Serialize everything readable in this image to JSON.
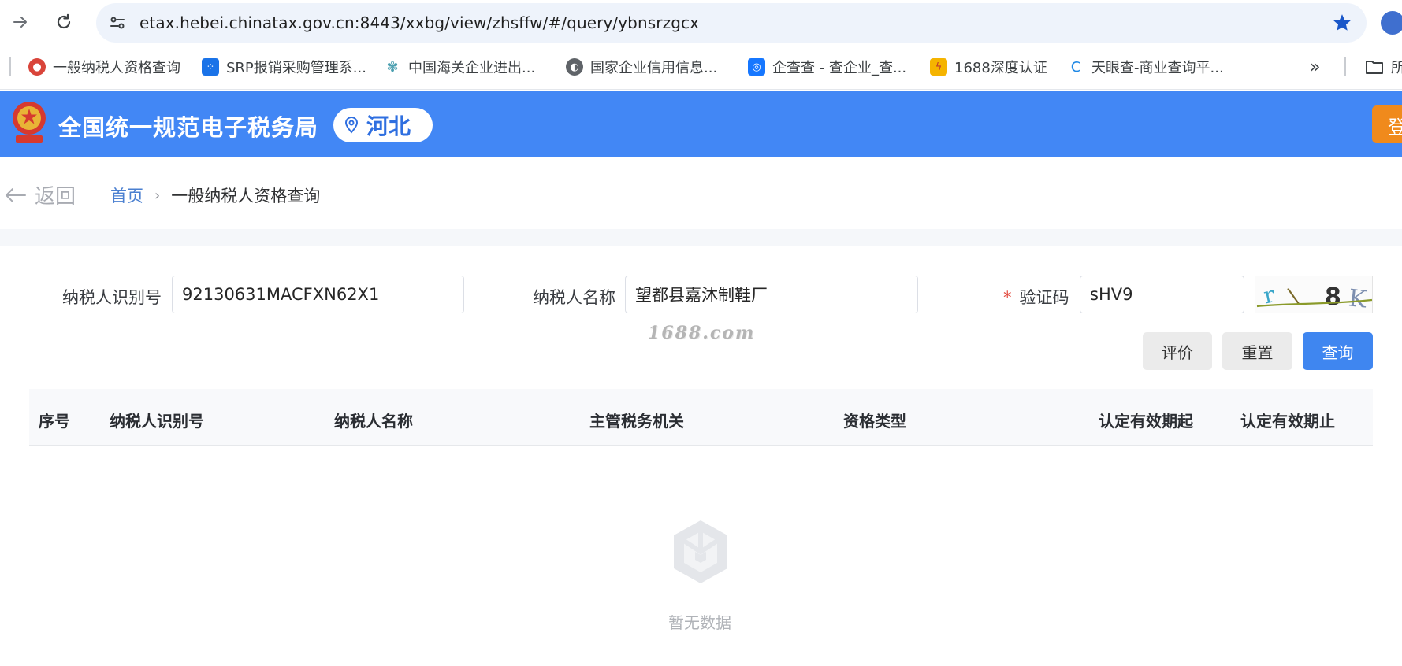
{
  "browser": {
    "url": "etax.hebei.chinatax.gov.cn:8443/xxbg/view/zhsffw/#/query/ybnsrzgcx",
    "bookmarks": [
      {
        "label": "一般纳税人资格查询",
        "icon": "tax-emblem-icon",
        "color": "#d9443a"
      },
      {
        "label": "SRP报销采购管理系...",
        "icon": "srp-icon",
        "color": "#1a73e8"
      },
      {
        "label": "中国海关企业进出...",
        "icon": "customs-icon",
        "color": "#4a9fb0"
      },
      {
        "label": "国家企业信用信息...",
        "icon": "globe-icon",
        "color": "#5f6368"
      },
      {
        "label": "企查查 - 查企业_查...",
        "icon": "qichacha-icon",
        "color": "#1677ff"
      },
      {
        "label": "1688深度认证",
        "icon": "1688-icon",
        "color": "#f5b400"
      },
      {
        "label": "天眼查-商业查询平...",
        "icon": "tianyancha-icon",
        "color": "#1e88e5"
      }
    ],
    "more_label": "»",
    "folder_label": "所"
  },
  "header": {
    "title": "全国统一规范电子税务局",
    "region": "河北",
    "login_label": "登"
  },
  "breadcrumb": {
    "back_label": "返回",
    "home": "首页",
    "separator": "›",
    "current": "一般纳税人资格查询"
  },
  "form": {
    "taxpayer_id_label": "纳税人识别号",
    "taxpayer_id_value": "92130631MACFXN62X1",
    "taxpayer_name_label": "纳税人名称",
    "taxpayer_name_value": "望都县嘉沐制鞋厂",
    "captcha_required_mark": "*",
    "captcha_label": "验证码",
    "captcha_value": "sHV9",
    "captcha_image_text": "r\\8K",
    "watermark": "1688.com"
  },
  "buttons": {
    "evaluate": "评价",
    "reset": "重置",
    "query": "查询"
  },
  "table": {
    "columns": [
      "序号",
      "纳税人识别号",
      "纳税人名称",
      "主管税务机关",
      "资格类型",
      "认定有效期起",
      "认定有效期止"
    ],
    "empty_text": "暂无数据"
  },
  "colors": {
    "header_bg": "#4287f5",
    "primary_button": "#3f86f0",
    "login_button": "#f08a1c",
    "required_mark": "#e2493d"
  }
}
